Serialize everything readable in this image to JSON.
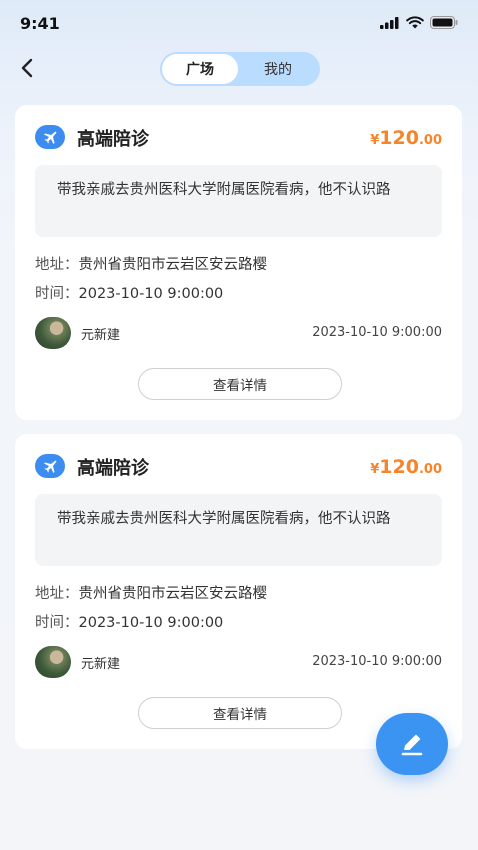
{
  "status": {
    "time": "9:41"
  },
  "nav": {
    "tabs": [
      {
        "label": "广场",
        "active": true
      },
      {
        "label": "我的",
        "active": false
      }
    ]
  },
  "cards": [
    {
      "title": "高端陪诊",
      "price_currency": "¥",
      "price_int": "120",
      "price_dec": ".00",
      "description": "带我亲戚去贵州医科大学附属医院看病，他不认识路",
      "address_label": "地址：",
      "address": "贵州省贵阳市云岩区安云路樱",
      "time_label": "时间：",
      "time": "2023-10-10 9:00:00",
      "user_name": "元新建",
      "post_time": "2023-10-10 9:00:00",
      "detail_label": "查看详情"
    },
    {
      "title": "高端陪诊",
      "price_currency": "¥",
      "price_int": "120",
      "price_dec": ".00",
      "description": "带我亲戚去贵州医科大学附属医院看病，他不认识路",
      "address_label": "地址：",
      "address": "贵州省贵阳市云岩区安云路樱",
      "time_label": "时间：",
      "time": "2023-10-10 9:00:00",
      "user_name": "元新建",
      "post_time": "2023-10-10 9:00:00",
      "detail_label": "查看详情"
    }
  ],
  "colors": {
    "accent": "#3b93f2",
    "price": "#f5852b",
    "segment_bg": "#b9dcff"
  },
  "icons": [
    "back-icon",
    "signal-icon",
    "wifi-icon",
    "battery-icon",
    "plane-icon",
    "edit-icon"
  ]
}
